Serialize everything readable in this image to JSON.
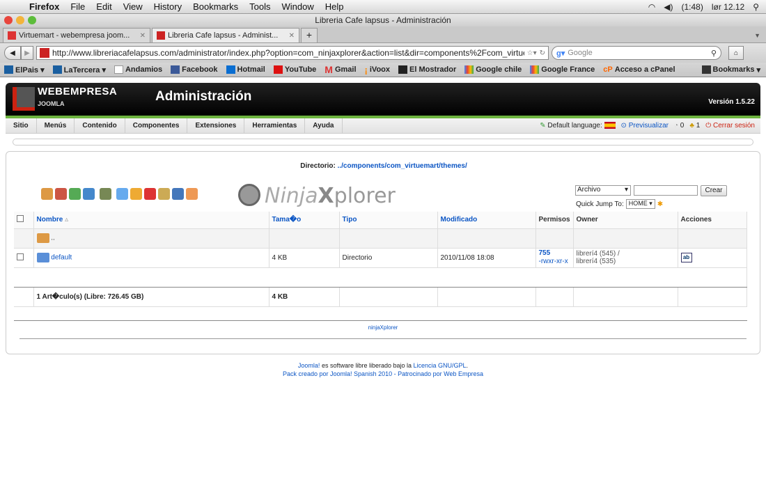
{
  "mac_menu": {
    "app": "Firefox",
    "items": [
      "File",
      "Edit",
      "View",
      "History",
      "Bookmarks",
      "Tools",
      "Window",
      "Help"
    ],
    "battery": "(1:48)",
    "clock": "lør 12.12"
  },
  "window": {
    "title": "Libreria Cafe lapsus - Administración"
  },
  "tabs": [
    {
      "label": "Virtuemart - webempresa joom..."
    },
    {
      "label": "Libreria Cafe lapsus - Administ..."
    }
  ],
  "address": {
    "url": "http://www.libreriacafelapsus.com/administrator/index.php?option=com_ninjaxplorer&action=list&dir=components%2Fcom_virtuema",
    "search_placeholder": "Google"
  },
  "bookmarks": [
    "ElPais ▾",
    "LaTercera ▾",
    "Andamios",
    "Facebook",
    "Hotmail",
    "YouTube",
    "Gmail",
    "iVoox",
    "El Mostrador",
    "Google chile",
    "Google France",
    "Acceso a cPanel"
  ],
  "bookmarks_menu": "Bookmarks",
  "joomla": {
    "brand": "WEBEMPRESA",
    "brand_sub": "JOOMLA",
    "title": "Administración",
    "version": "Versión 1.5.22",
    "menu": [
      "Sitio",
      "Menús",
      "Contenido",
      "Componentes",
      "Extensiones",
      "Herramientas",
      "Ayuda"
    ],
    "status": {
      "language": "Default language:",
      "preview": "Previsualizar",
      "messages": "0",
      "users": "1",
      "logout": "Cerrar sesión"
    }
  },
  "explorer": {
    "dir_label": "Directorio:",
    "dir_path": "../components/com_virtuemart/themes/",
    "logo_text": "Ninja",
    "logo_x": "X",
    "logo_rest": "plorer",
    "archivo": "Archivo",
    "crear": "Crear",
    "quick_jump": "Quick Jump To:",
    "quick_jump_value": "HOME",
    "columns": [
      "Nombre",
      "Tama�o",
      "Tipo",
      "Modificado",
      "Permisos",
      "Owner",
      "Acciones"
    ],
    "sort_indicator": "▵",
    "parent_label": "..",
    "rows": [
      {
        "name": "default",
        "size": "4 KB",
        "type": "Directorio",
        "modified": "2010/11/08 18:08",
        "perm_octal": "755",
        "perm_str": "-rwxr-xr-x",
        "owner1": "librerí4 (545) /",
        "owner2": "librerí4 (535)"
      }
    ],
    "summary": {
      "label": "1 Art�culo(s) (Libre: 726.45 GB)",
      "size": "4 KB"
    },
    "footer_link": "ninjaXplorer"
  },
  "footer": {
    "line1_link": "Joomla!",
    "line1_mid": " es software libre liberado bajo la ",
    "line1_link2": "Licencia GNU/GPL",
    "line1_end": ".",
    "line2": "Pack creado por Joomla! Spanish 2010 - Patrocinado por Web Empresa"
  }
}
